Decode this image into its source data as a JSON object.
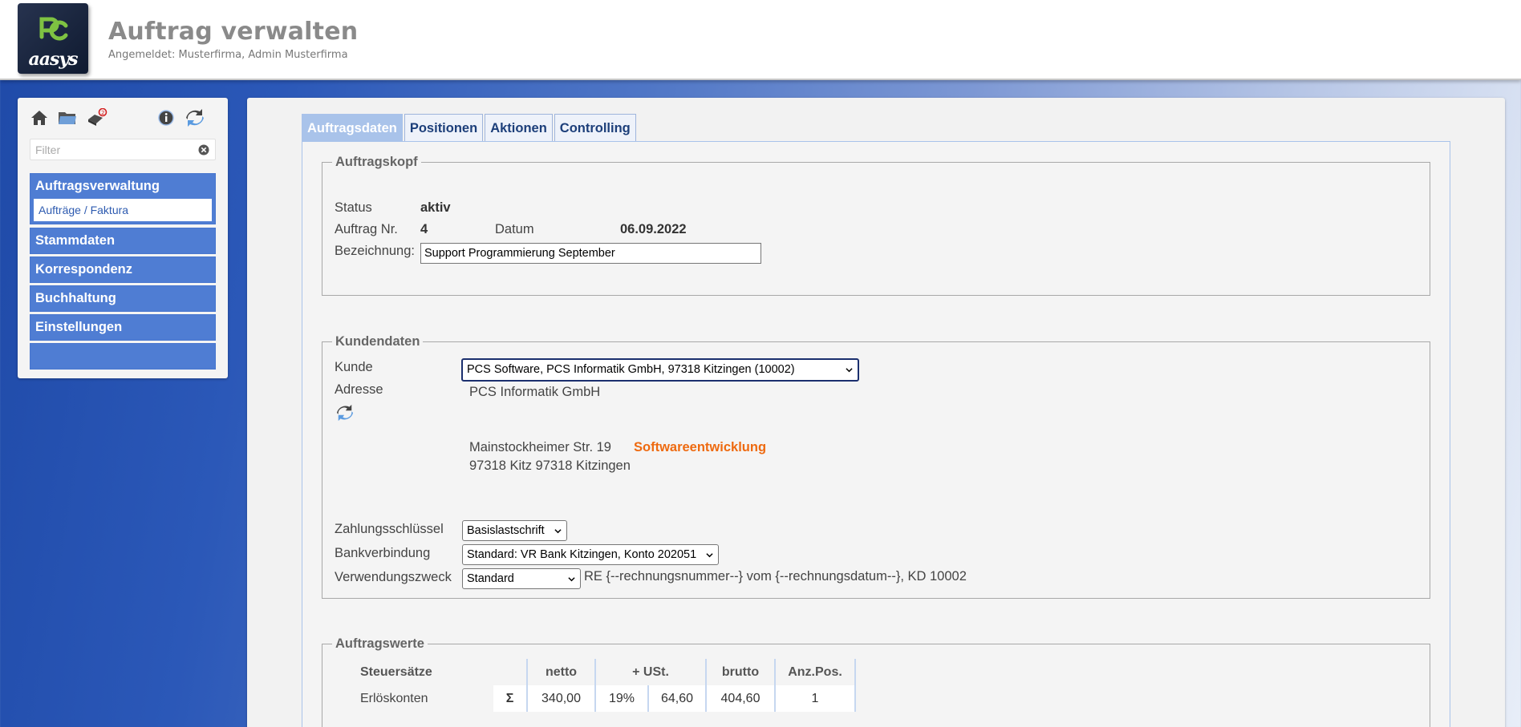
{
  "header": {
    "logo_text": "aasys",
    "title": "Auftrag verwalten",
    "login_info": "Angemeldet: Musterfirma, Admin Musterfirma"
  },
  "sidebar": {
    "filter_placeholder": "Filter",
    "nav": [
      {
        "label": "Auftragsverwaltung",
        "sub": "Aufträge / Faktura"
      },
      {
        "label": "Stammdaten"
      },
      {
        "label": "Korrespondenz"
      },
      {
        "label": "Buchhaltung"
      },
      {
        "label": "Einstellungen"
      }
    ]
  },
  "tabs": [
    "Auftragsdaten",
    "Positionen",
    "Aktionen",
    "Controlling"
  ],
  "auftragskopf": {
    "legend": "Auftragskopf",
    "status_label": "Status",
    "status_value": "aktiv",
    "auftrag_nr_label": "Auftrag Nr.",
    "auftrag_nr_value": "4",
    "datum_label": "Datum",
    "datum_value": "06.09.2022",
    "bezeichnung_label": "Bezeichnung:",
    "bezeichnung_value": "Support Programmierung September"
  },
  "kundendaten": {
    "legend": "Kundendaten",
    "kunde_label": "Kunde",
    "kunde_value": "PCS Software, PCS Informatik GmbH, 97318 Kitzingen (10002)",
    "adresse_label": "Adresse",
    "address_line1": "PCS Informatik GmbH",
    "address_street": "Mainstockheimer Str. 19",
    "address_city": "97318 Kitz 97318 Kitzingen",
    "category": "Softwareentwicklung",
    "zahlung_label": "Zahlungsschlüssel",
    "zahlung_value": "Basislastschrift",
    "bank_label": "Bankverbindung",
    "bank_value": "Standard: VR Bank Kitzingen, Konto 202051",
    "zweck_label": "Verwendungszweck",
    "zweck_value": "Standard",
    "zweck_text": "RE {--rechnungsnummer--} vom {--rechnungsdatum--}, KD 10002"
  },
  "auftragswerte": {
    "legend": "Auftragswerte",
    "headers": {
      "steuer": "Steuersätze",
      "netto": "netto",
      "ust": "+ USt.",
      "brutto": "brutto",
      "anz": "Anz.Pos."
    },
    "row": {
      "label": "Erlöskonten",
      "sigma": "Σ",
      "netto": "340,00",
      "ust_rate": "19%",
      "ust": "64,60",
      "brutto": "404,60",
      "anz": "1"
    }
  }
}
